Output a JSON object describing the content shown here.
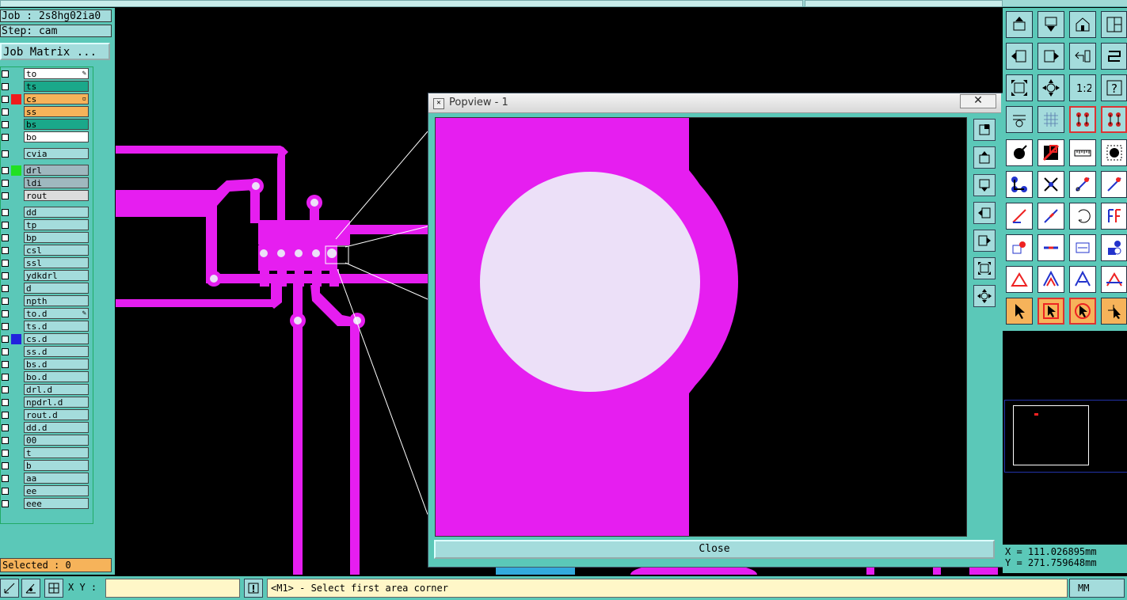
{
  "job_label": "Job : 2s8hg02ia0",
  "step_label": "Step: cam",
  "job_matrix_button": "Job Matrix ...",
  "layers": [
    {
      "name": "to",
      "bg": "#ffffff",
      "color": "",
      "mark": "✎"
    },
    {
      "name": "ts",
      "bg": "#1aa88a",
      "color": "",
      "mark": ""
    },
    {
      "name": "cs",
      "bg": "#f6b35a",
      "color": "#ee1c1c",
      "mark": "▫"
    },
    {
      "name": "ss",
      "bg": "#f6b35a",
      "color": "",
      "mark": ""
    },
    {
      "name": "bs",
      "bg": "#1aa88a",
      "color": "",
      "mark": ""
    },
    {
      "name": "bo",
      "bg": "#ffffff",
      "color": "",
      "mark": ""
    },
    {
      "name": "cvia",
      "bg": "#a4dcdc",
      "color": "",
      "mark": ""
    },
    {
      "name": "drl",
      "bg": "#9fb8bf",
      "color": "#22e022",
      "mark": ""
    },
    {
      "name": "ldi",
      "bg": "#9fb8bf",
      "color": "",
      "mark": ""
    },
    {
      "name": "rout",
      "bg": "#dcdcdc",
      "color": "",
      "mark": ""
    },
    {
      "name": "dd",
      "bg": "#a4dcdc",
      "color": "",
      "mark": ""
    },
    {
      "name": "tp",
      "bg": "#a4dcdc",
      "color": "",
      "mark": ""
    },
    {
      "name": "bp",
      "bg": "#a4dcdc",
      "color": "",
      "mark": ""
    },
    {
      "name": "csl",
      "bg": "#a4dcdc",
      "color": "",
      "mark": ""
    },
    {
      "name": "ssl",
      "bg": "#a4dcdc",
      "color": "",
      "mark": ""
    },
    {
      "name": "ydkdrl",
      "bg": "#a4dcdc",
      "color": "",
      "mark": ""
    },
    {
      "name": "d",
      "bg": "#a4dcdc",
      "color": "",
      "mark": ""
    },
    {
      "name": "npth",
      "bg": "#a4dcdc",
      "color": "",
      "mark": ""
    },
    {
      "name": "to.d",
      "bg": "#a4dcdc",
      "color": "",
      "mark": "✎"
    },
    {
      "name": "ts.d",
      "bg": "#a4dcdc",
      "color": "",
      "mark": ""
    },
    {
      "name": "cs.d",
      "bg": "#a4dcdc",
      "color": "#2222dd",
      "mark": ""
    },
    {
      "name": "ss.d",
      "bg": "#a4dcdc",
      "color": "",
      "mark": ""
    },
    {
      "name": "bs.d",
      "bg": "#a4dcdc",
      "color": "",
      "mark": ""
    },
    {
      "name": "bo.d",
      "bg": "#a4dcdc",
      "color": "",
      "mark": ""
    },
    {
      "name": "drl.d",
      "bg": "#a4dcdc",
      "color": "",
      "mark": ""
    },
    {
      "name": "npdrl.d",
      "bg": "#a4dcdc",
      "color": "",
      "mark": ""
    },
    {
      "name": "rout.d",
      "bg": "#a4dcdc",
      "color": "",
      "mark": ""
    },
    {
      "name": "dd.d",
      "bg": "#a4dcdc",
      "color": "",
      "mark": ""
    },
    {
      "name": "00",
      "bg": "#a4dcdc",
      "color": "",
      "mark": ""
    },
    {
      "name": "t",
      "bg": "#a4dcdc",
      "color": "",
      "mark": ""
    },
    {
      "name": "b",
      "bg": "#a4dcdc",
      "color": "",
      "mark": ""
    },
    {
      "name": "aa",
      "bg": "#a4dcdc",
      "color": "",
      "mark": ""
    },
    {
      "name": "ee",
      "bg": "#a4dcdc",
      "color": "",
      "mark": ""
    },
    {
      "name": "eee",
      "bg": "#a4dcdc",
      "color": "",
      "mark": ""
    }
  ],
  "selected_label": "Selected : 0",
  "popview": {
    "title": "Popview - 1",
    "close_x": "✕",
    "close_button": "Close"
  },
  "coords": {
    "x": "X = 111.026895mm",
    "y": "Y = 271.759648mm"
  },
  "bottom": {
    "xy_label": "X Y :",
    "xy_value": "",
    "message": "<M1> - Select first area corner",
    "units": "MM"
  },
  "colors": {
    "trace": "#e61ef0",
    "pad_hole": "#ece0f8",
    "panel": "#5bc8b8",
    "button": "#a4dcdc"
  }
}
